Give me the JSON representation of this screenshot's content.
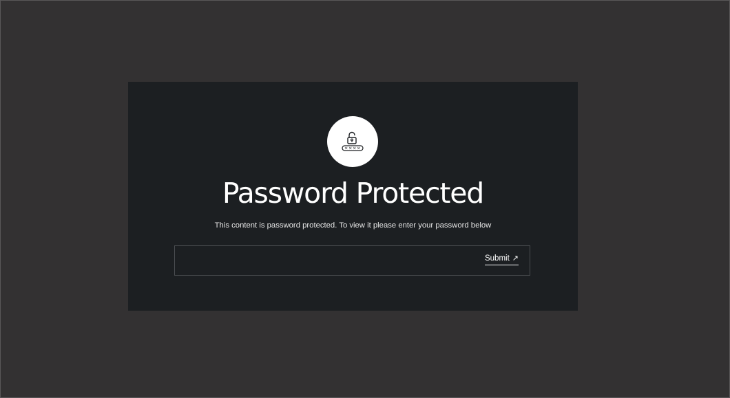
{
  "card": {
    "title": "Password Protected",
    "subtitle": "This content is password protected. To view it please enter your password below",
    "lock_icon": "unlocked-padlock-with-password-field-icon",
    "lock_mask": "××××"
  },
  "form": {
    "password_value": "",
    "submit_label": "Submit",
    "submit_icon": "↗"
  },
  "colors": {
    "page_background": "#333132",
    "card_background": "#1c1f22",
    "text": "#ffffff",
    "input_border": "#4a4d51"
  }
}
